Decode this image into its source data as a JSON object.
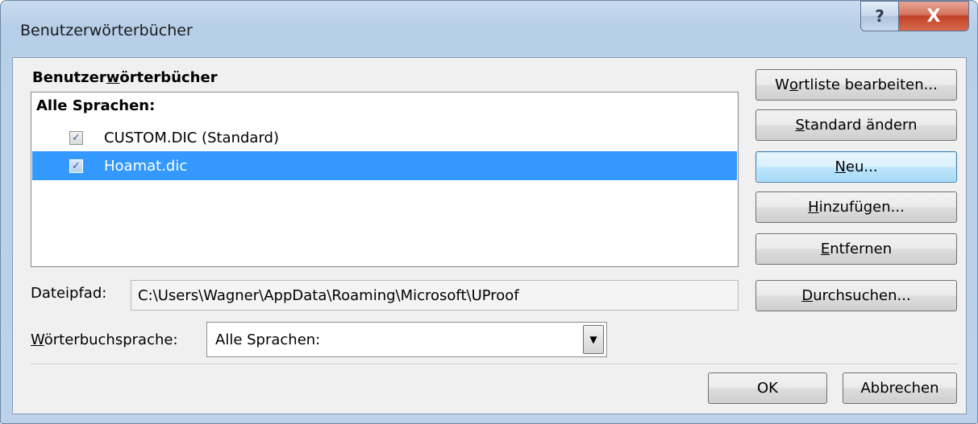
{
  "window": {
    "title": "Benutzerwörterbücher",
    "help_glyph": "?",
    "close_glyph": "X"
  },
  "dictionaries": {
    "group_label": {
      "pre": "Benutzer",
      "ul": "w",
      "post": "örterbücher"
    },
    "list_header": "Alle Sprachen:",
    "items": [
      {
        "label": "CUSTOM.DIC (Standard)",
        "checked": true,
        "selected": false
      },
      {
        "label": "Hoamat.dic",
        "checked": true,
        "selected": true
      }
    ]
  },
  "buttons": {
    "edit_wordlist": {
      "pre": "W",
      "ul": "o",
      "post": "rtliste bearbeiten..."
    },
    "change_default": {
      "pre": "",
      "ul": "S",
      "post": "tandard ändern"
    },
    "new": {
      "pre": "",
      "ul": "N",
      "post": "eu..."
    },
    "add": {
      "pre": "",
      "ul": "H",
      "post": "inzufügen..."
    },
    "remove": {
      "pre": "",
      "ul": "E",
      "post": "ntfernen"
    },
    "browse": {
      "pre": "",
      "ul": "D",
      "post": "urchsuchen..."
    },
    "ok": "OK",
    "cancel": "Abbrechen"
  },
  "file_path": {
    "label": "Dateipfad:",
    "value": "C:\\Users\\Wagner\\AppData\\Roaming\\Microsoft\\UProof"
  },
  "language": {
    "label": {
      "pre": "",
      "ul": "W",
      "post": "örterbuchsprache:"
    },
    "selected": "Alle Sprachen:"
  },
  "colors": {
    "selection": "#3399ff",
    "dialog_bg": "#f0f0f0",
    "titlebar": "#bcd2ea",
    "close_button": "#c24128"
  }
}
